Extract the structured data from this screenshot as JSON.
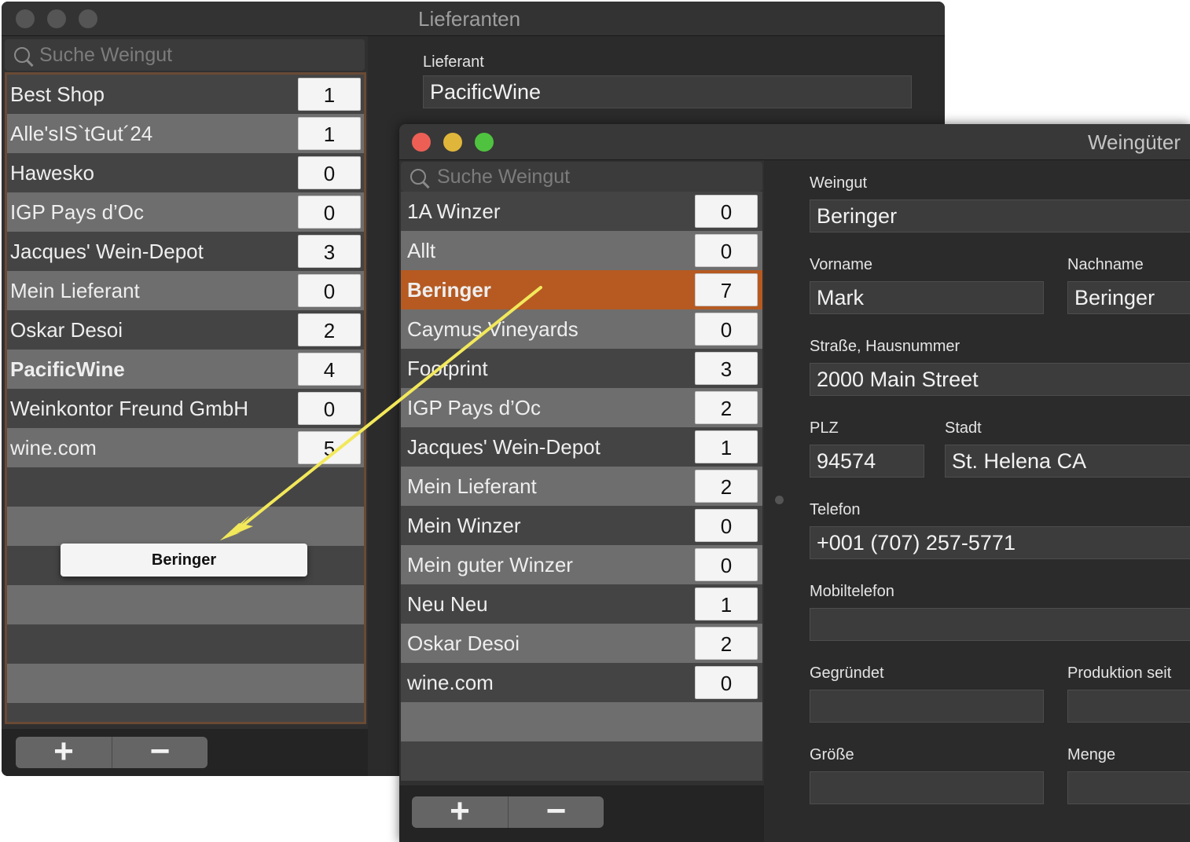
{
  "back_window": {
    "title": "Lieferanten",
    "search_placeholder": "Suche Weingut",
    "rows": [
      {
        "name": "Best Shop",
        "count": "1",
        "bold": false
      },
      {
        "name": "Alle'sIS`tGut´24",
        "count": "1",
        "bold": false
      },
      {
        "name": "Hawesko",
        "count": "0",
        "bold": false
      },
      {
        "name": "IGP Pays d’Oc",
        "count": "0",
        "bold": false
      },
      {
        "name": "Jacques' Wein-Depot",
        "count": "3",
        "bold": false
      },
      {
        "name": "Mein Lieferant",
        "count": "0",
        "bold": false
      },
      {
        "name": "Oskar Desoi",
        "count": "2",
        "bold": false
      },
      {
        "name": "PacificWine",
        "count": "4",
        "bold": true
      },
      {
        "name": "Weinkontor Freund GmbH",
        "count": "0",
        "bold": false
      },
      {
        "name": "wine.com",
        "count": "5",
        "bold": false
      }
    ],
    "detail": {
      "lieferant_label": "Lieferant",
      "lieferant_value": "PacificWine"
    },
    "add_label": "+",
    "remove_label": "−"
  },
  "drag_ghost_label": "Beringer",
  "front_window": {
    "title": "Weingüter",
    "search_placeholder": "Suche Weingut",
    "rows": [
      {
        "name": "1A Winzer",
        "count": "0",
        "selected": false
      },
      {
        "name": "Allt",
        "count": "0",
        "selected": false
      },
      {
        "name": "Beringer",
        "count": "7",
        "selected": true
      },
      {
        "name": "Caymus Vineyards",
        "count": "0",
        "selected": false
      },
      {
        "name": "Footprint",
        "count": "3",
        "selected": false
      },
      {
        "name": "IGP Pays d’Oc",
        "count": "2",
        "selected": false
      },
      {
        "name": "Jacques' Wein-Depot",
        "count": "1",
        "selected": false
      },
      {
        "name": "Mein Lieferant",
        "count": "2",
        "selected": false
      },
      {
        "name": "Mein Winzer",
        "count": "0",
        "selected": false
      },
      {
        "name": "Mein guter Winzer",
        "count": "0",
        "selected": false
      },
      {
        "name": "Neu Neu",
        "count": "1",
        "selected": false
      },
      {
        "name": "Oskar Desoi",
        "count": "2",
        "selected": false
      },
      {
        "name": "wine.com",
        "count": "0",
        "selected": false
      }
    ],
    "add_label": "+",
    "remove_label": "−",
    "form": {
      "weingut_label": "Weingut",
      "weingut_value": "Beringer",
      "vorname_label": "Vorname",
      "vorname_value": "Mark",
      "nachname_label": "Nachname",
      "nachname_value": "Beringer",
      "strasse_label": "Straße, Hausnummer",
      "strasse_value": "2000 Main Street",
      "plz_label": "PLZ",
      "plz_value": "94574",
      "stadt_label": "Stadt",
      "stadt_value": "St. Helena CA",
      "telefon_label": "Telefon",
      "telefon_value": "+001 (707) 257-5771",
      "mobil_label": "Mobiltelefon",
      "mobil_value": "",
      "gegruendet_label": "Gegründet",
      "gegruendet_value": "",
      "produktion_label": "Produktion seit",
      "produktion_value": "",
      "groesse_label": "Größe",
      "groesse_value": "",
      "menge_label": "Menge",
      "menge_value": ""
    }
  },
  "colors": {
    "selection": "#b65a22",
    "drag_arrow": "#f2e85a",
    "close": "#ed5f55",
    "minimize": "#e0b63a",
    "zoom": "#4fc33f"
  }
}
